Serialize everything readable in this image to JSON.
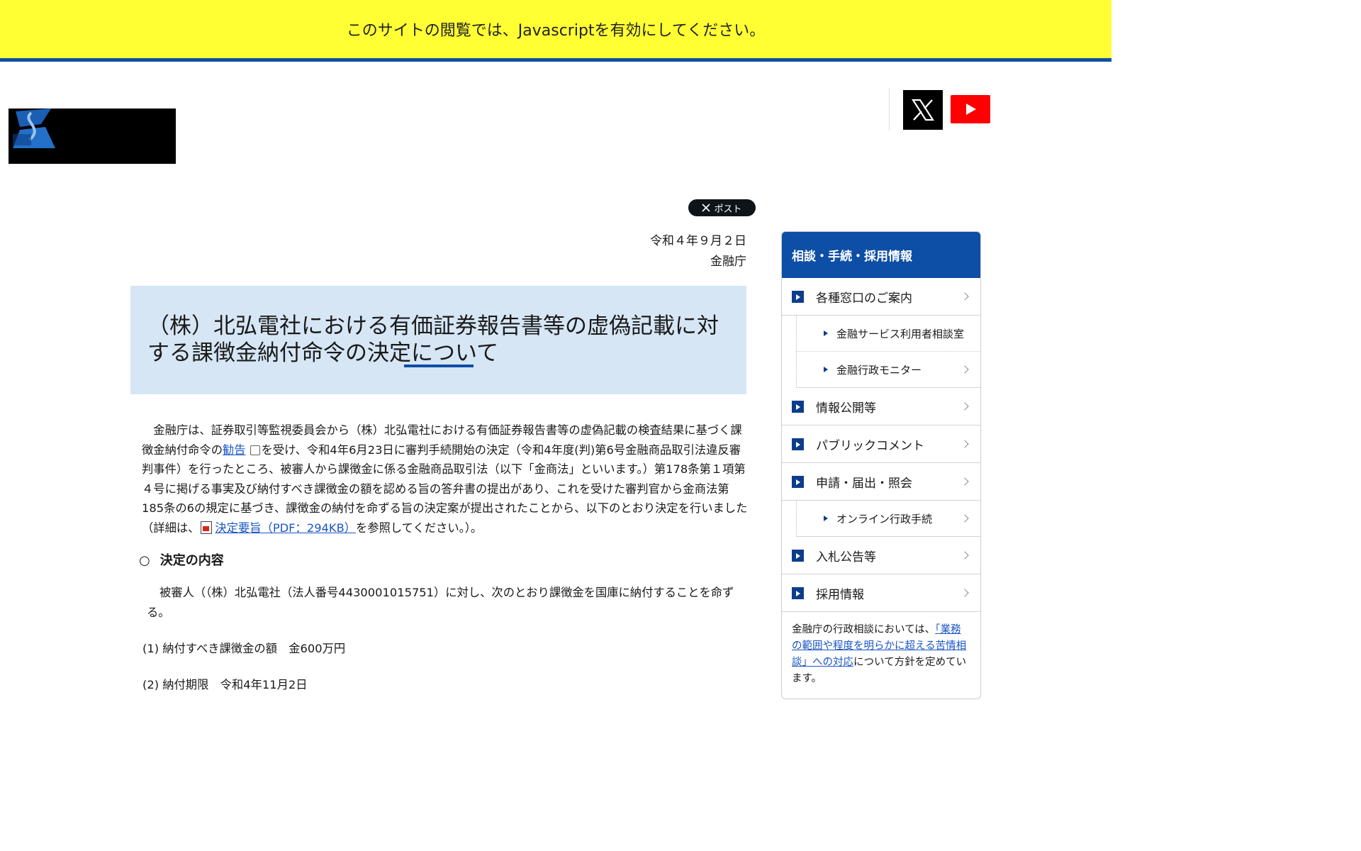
{
  "banner": {
    "text": "このサイトの閲覧では、Javascriptを有効にしてください。"
  },
  "social": {
    "x_icon": "x-logo-icon",
    "youtube_icon": "youtube-play-icon"
  },
  "post_button": {
    "label": "ポスト"
  },
  "document": {
    "date": "令和４年９月２日",
    "agency": "金融庁",
    "title": "（株）北弘電社における有価証券報告書等の虚偽記載に対する課徴金納付命令の決定について",
    "para_1": "　金融庁は、証券取引等監視委員会から（株）北弘電社における有価証券報告書等の虚偽記載の検査結果に基づく課徴金納付命令の",
    "link_kankoku": "勧告",
    "para_2": "を受け、令和4年6月23日に審判手続開始の決定（令和4年度(判)第6号金融商品取引法違反審判事件）を行ったところ、被審人から課徴金に係る金融商品取引法（以下「金商法」といいます。）第178条第１項第４号に掲げる事実及び納付すべき課徴金の額を認める旨の答弁書の提出があり、これを受けた審判官から金商法第185条の6の規定に基づき、課徴金の納付を命ずる旨の決定案が提出されたことから、以下のとおり決定を行いました（詳細は、",
    "link_pdf": "決定要旨（PDF：294KB）",
    "para_3": "を参照してください。）。",
    "section_bullet": "○",
    "section_heading": "決定の内容",
    "decision_text": "被審人（（株）北弘電社（法人番号4430001015751）に対し、次のとおり課徴金を国庫に納付することを命ずる。",
    "item_1": "(1) 納付すべき課徴金の額　金600万円",
    "item_2": "(2) 納付期限　令和4年11月2日"
  },
  "sidebar": {
    "heading": "相談・手続・採用情報",
    "items": {
      "madoguchi": "各種窓口のご案内",
      "riyousha": "金融サービス利用者相談室",
      "monitor": "金融行政モニター",
      "joho": "情報公開等",
      "public_comment": "パブリックコメント",
      "shinsei": "申請・届出・照会",
      "online": "オンライン行政手続",
      "nyusatsu": "入札公告等",
      "saiyo": "採用情報"
    },
    "note_prefix": "金融庁の行政相談においては、",
    "note_link": "「業務の範囲や程度を明らかに超える苦情相談」への対応",
    "note_suffix": "について方針を定めています。"
  },
  "colors": {
    "banner_bg": "#ffff33",
    "brand_blue": "#0d4ea6",
    "title_bg": "#d6e6f5",
    "link": "#1a55c4"
  }
}
